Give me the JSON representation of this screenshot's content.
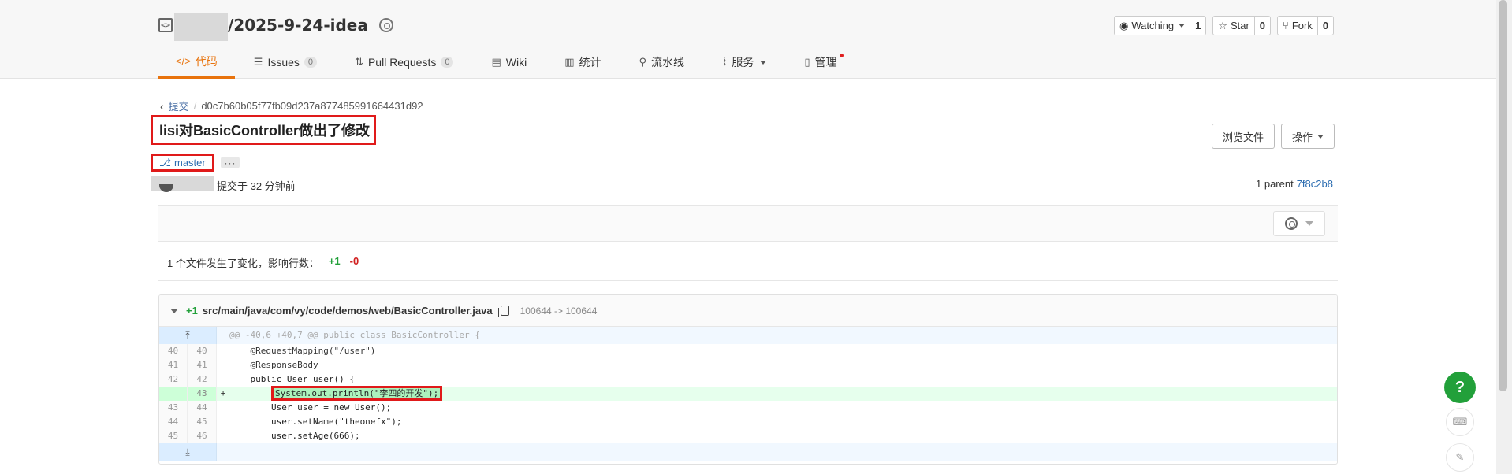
{
  "repo": {
    "name": "/2025-9-24-idea"
  },
  "actions": {
    "watch_label": "Watching",
    "watch_count": "1",
    "star_label": "Star",
    "star_count": "0",
    "fork_label": "Fork",
    "fork_count": "0"
  },
  "tabs": [
    {
      "label": "代码",
      "icon": "code-icon"
    },
    {
      "label": "Issues",
      "count": "0",
      "icon": "issues-icon"
    },
    {
      "label": "Pull Requests",
      "count": "0",
      "icon": "pull-request-icon"
    },
    {
      "label": "Wiki",
      "icon": "wiki-icon"
    },
    {
      "label": "统计",
      "icon": "stats-icon"
    },
    {
      "label": "流水线",
      "icon": "pipeline-icon"
    },
    {
      "label": "服务",
      "icon": "service-icon"
    },
    {
      "label": "管理",
      "icon": "manage-icon"
    }
  ],
  "breadcrumb": {
    "back_label": "提交",
    "sha": "d0c7b60b05f77fb09d237a877485991664431d92"
  },
  "commit": {
    "title": "lisi对BasicController做出了修改",
    "branch": "master",
    "time": "提交于 32 分钟前",
    "parent_label": "1 parent",
    "parent_sha": "7f8c2b8"
  },
  "buttons": {
    "browse": "浏览文件",
    "operations": "操作"
  },
  "summary": {
    "text": "1 个文件发生了变化，影响行数：",
    "plus": "+1",
    "minus": "-0"
  },
  "diff": {
    "adds": "+1",
    "path": "src/main/java/com/vy/code/demos/web/BasicController.java",
    "mode": "100644 -> 100644",
    "hunk": "@@ -40,6 +40,7 @@ public class BasicController {",
    "lines": [
      {
        "old": "40",
        "new": "40",
        "sign": "",
        "code": "    @RequestMapping(\"/user\")"
      },
      {
        "old": "41",
        "new": "41",
        "sign": "",
        "code": "    @ResponseBody"
      },
      {
        "old": "42",
        "new": "42",
        "sign": "",
        "code": "    public User user() {"
      },
      {
        "old": "",
        "new": "43",
        "sign": "+",
        "code": "System.out.println(\"李四的开发\");"
      },
      {
        "old": "43",
        "new": "44",
        "sign": "",
        "code": "        User user = new User();"
      },
      {
        "old": "44",
        "new": "45",
        "sign": "",
        "code": "        user.setName(\"theonefx\");"
      },
      {
        "old": "45",
        "new": "46",
        "sign": "",
        "code": "        user.setAge(666);"
      }
    ]
  },
  "help": "?"
}
